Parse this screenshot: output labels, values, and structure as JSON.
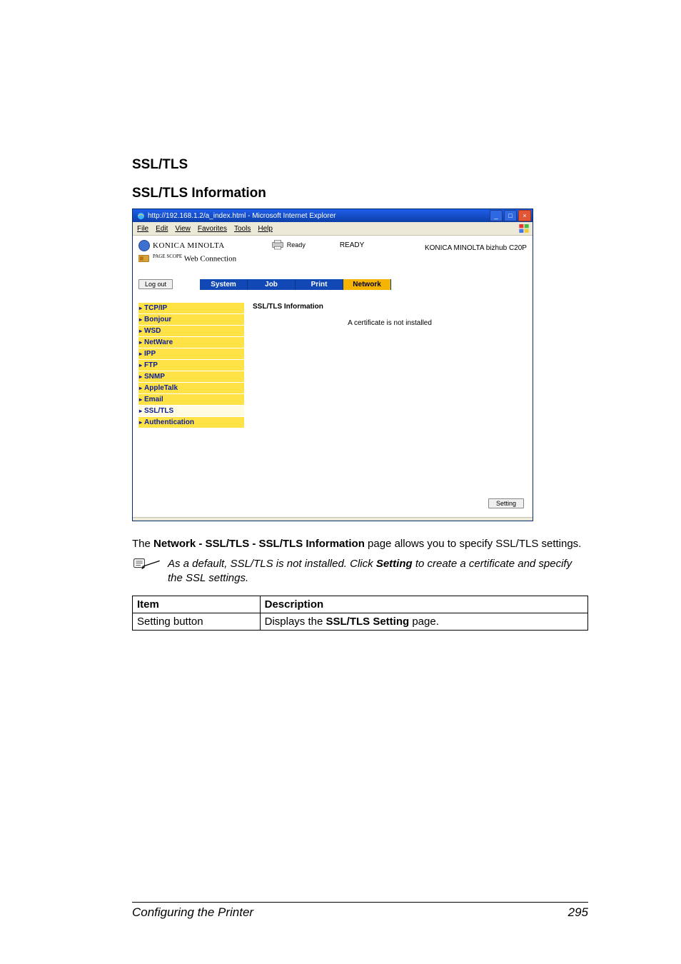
{
  "headings": {
    "main": "SSL/TLS",
    "sub": "SSL/TLS Information"
  },
  "browser": {
    "title": "http://192.168.1.2/a_index.html - Microsoft Internet Explorer",
    "menu": [
      "File",
      "Edit",
      "View",
      "Favorites",
      "Tools",
      "Help"
    ],
    "brand": "KONICA MINOLTA",
    "web_connection_scope": "PAGE SCOPE",
    "web_connection_label": "Web Connection",
    "status_label": "Ready",
    "status_big": "READY",
    "model": "KONICA MINOLTA bizhub C20P",
    "logout": "Log out",
    "tabs": [
      "System",
      "Job",
      "Print",
      "Network"
    ],
    "active_tab": 3,
    "sidebar": [
      "TCP/IP",
      "Bonjour",
      "WSD",
      "NetWare",
      "IPP",
      "FTP",
      "SNMP",
      "AppleTalk",
      "Email",
      "SSL/TLS",
      "Authentication"
    ],
    "sidebar_selected": 9,
    "panel_title": "SSL/TLS Information",
    "panel_msg": "A certificate is not installed",
    "setting_btn": "Setting"
  },
  "paragraph": {
    "pre": "The ",
    "bold": "Network - SSL/TLS - SSL/TLS Information",
    "post": " page allows you to specify SSL/TLS settings."
  },
  "note": {
    "pre": "As a default, SSL/TLS is not installed. Click ",
    "bold": "Setting",
    "post": " to create a certificate and specify the SSL settings."
  },
  "table": {
    "headers": [
      "Item",
      "Description"
    ],
    "row_item": "Setting button",
    "row_desc_pre": "Displays the ",
    "row_desc_bold": "SSL/TLS Setting",
    "row_desc_post": " page."
  },
  "footer": {
    "left": "Configuring the Printer",
    "right": "295"
  }
}
